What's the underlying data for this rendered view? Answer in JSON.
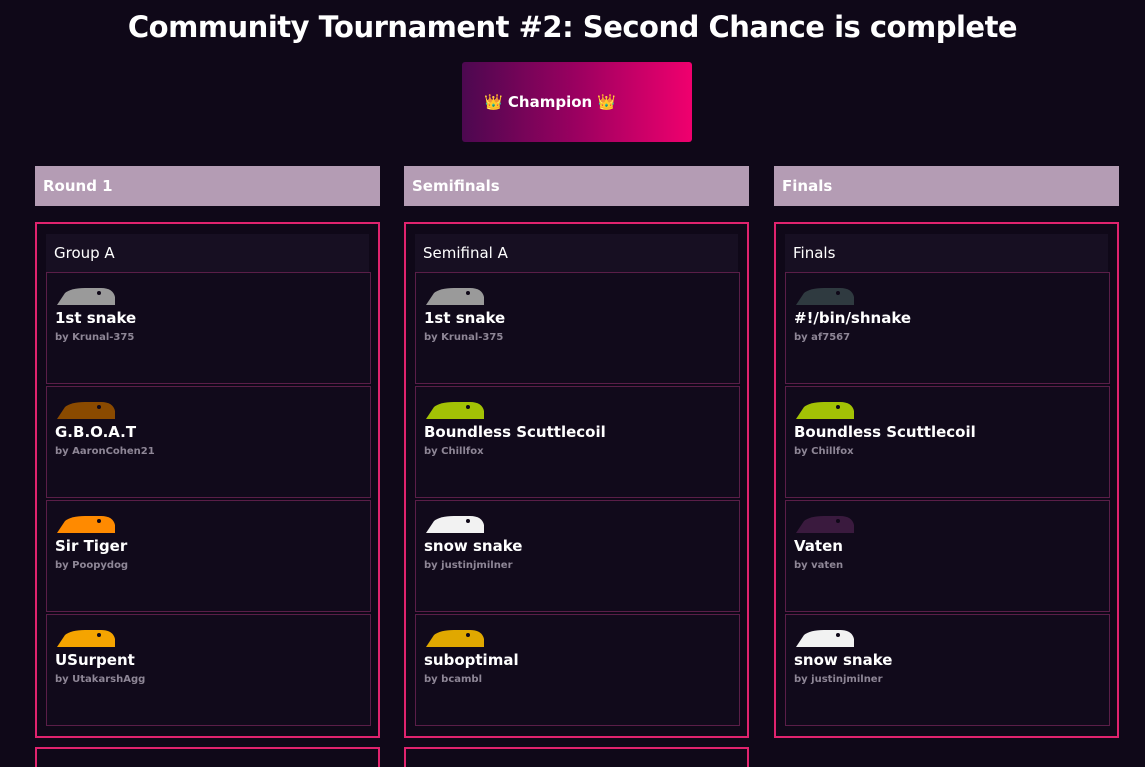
{
  "page": {
    "title": "Community Tournament #2: Second Chance is complete",
    "champion_label": "👑 Champion 👑"
  },
  "colors": {
    "background": "#0f0818",
    "accent_border": "#e0236e",
    "column_header": "#b49cb4",
    "champion_gradient_start": "#4c0850",
    "champion_gradient_end": "#f0006e"
  },
  "columns": [
    {
      "header": "Round 1",
      "group_title": "Group A",
      "entries": [
        {
          "name": "1st snake",
          "author": "by Krunal-375",
          "color": "#9a9a9a",
          "icon": "snake-head-icon"
        },
        {
          "name": "G.B.O.A.T",
          "author": "by AaronCohen21",
          "color": "#8a4a00",
          "icon": "snake-head-icon"
        },
        {
          "name": "Sir Tiger",
          "author": "by Poopydog",
          "color": "#ff8a00",
          "icon": "tiger-snake-icon"
        },
        {
          "name": "USurpent",
          "author": "by UtakarshAgg",
          "color": "#f5a400",
          "icon": "snake-head-icon"
        }
      ]
    },
    {
      "header": "Semifinals",
      "group_title": "Semifinal A",
      "entries": [
        {
          "name": "1st snake",
          "author": "by Krunal-375",
          "color": "#9a9a9a",
          "icon": "snake-head-icon"
        },
        {
          "name": "Boundless Scuttlecoil",
          "author": "by Chillfox",
          "color": "#a3c205",
          "icon": "snake-head-icon"
        },
        {
          "name": "snow snake",
          "author": "by justinjmilner",
          "color": "#f2f2f2",
          "icon": "snake-head-icon"
        },
        {
          "name": "suboptimal",
          "author": "by bcambl",
          "color": "#e0a800",
          "icon": "snake-head-icon"
        }
      ]
    },
    {
      "header": "Finals",
      "group_title": "Finals",
      "entries": [
        {
          "name": "#!/bin/shnake",
          "author": "by af7567",
          "color": "#2f3a40",
          "icon": "snake-head-icon"
        },
        {
          "name": "Boundless Scuttlecoil",
          "author": "by Chillfox",
          "color": "#a3c205",
          "icon": "snake-head-icon"
        },
        {
          "name": "Vaten",
          "author": "by vaten",
          "color": "#3a1a3e",
          "icon": "snake-head-icon"
        },
        {
          "name": "snow snake",
          "author": "by justinjmilner",
          "color": "#f2f2f2",
          "icon": "snake-head-icon"
        }
      ]
    }
  ]
}
